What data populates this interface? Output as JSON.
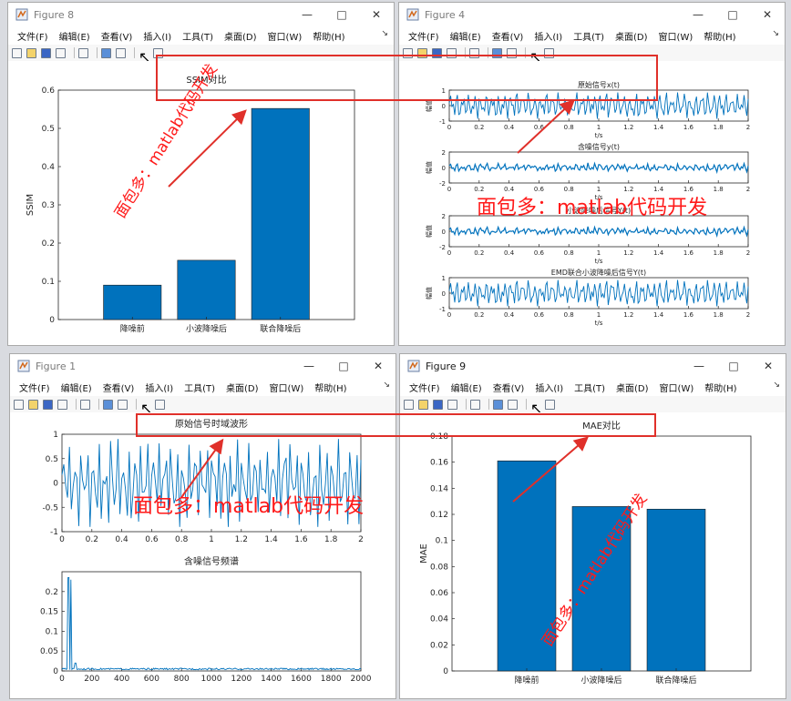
{
  "menu_items": [
    "文件(F)",
    "编辑(E)",
    "查看(V)",
    "插入(I)",
    "工具(T)",
    "桌面(D)",
    "窗口(W)",
    "帮助(H)"
  ],
  "icons": [
    "new-file-icon",
    "open-folder-icon",
    "save-icon",
    "print-icon",
    "link-icon",
    "insert-colorbar-icon",
    "insert-legend-icon",
    "pointer-icon",
    "property-inspector-icon"
  ],
  "watermark": "面包多：matlab代码开发",
  "colors": {
    "bar": "#0072BD",
    "line": "#0072BD",
    "watermark": "#ff1a1a"
  },
  "windows": {
    "fig8": {
      "title": "Figure 8"
    },
    "fig4": {
      "title": "Figure 4"
    },
    "fig1": {
      "title": "Figure 1"
    },
    "fig9": {
      "title": "Figure 9"
    }
  },
  "chart_data": [
    {
      "id": "ssim",
      "type": "bar",
      "title": "SSIM对比",
      "categories": [
        "降噪前",
        "小波降噪后",
        "联合降噪后"
      ],
      "values": [
        0.09,
        0.155,
        0.552
      ],
      "ylabel": "SSIM",
      "xlabel": "",
      "ylim": [
        0,
        0.6
      ],
      "yticks": [
        "0",
        "0.1",
        "0.2",
        "0.3",
        "0.4",
        "0.5",
        "0.6"
      ]
    },
    {
      "id": "mae",
      "type": "bar",
      "title": "MAE对比",
      "categories": [
        "降噪前",
        "小波降噪后",
        "联合降噪后"
      ],
      "values": [
        0.161,
        0.126,
        0.124
      ],
      "ylabel": "MAE",
      "xlabel": "",
      "ylim": [
        0,
        0.18
      ],
      "yticks": [
        "0",
        "0.02",
        "0.04",
        "0.06",
        "0.08",
        "0.1",
        "0.12",
        "0.14",
        "0.16",
        "0.18"
      ]
    },
    {
      "id": "sig1",
      "type": "line",
      "title": "原始信号x(t)",
      "xlabel": "t/s",
      "ylabel": "幅值",
      "xlim": [
        0,
        2
      ],
      "ylim": [
        -1,
        1
      ],
      "xticks": [
        "0",
        "0.2",
        "0.4",
        "0.6",
        "0.8",
        "1",
        "1.2",
        "1.4",
        "1.6",
        "1.8",
        "2"
      ],
      "yticks": [
        "-1",
        "0",
        "1"
      ]
    },
    {
      "id": "sig2",
      "type": "line",
      "title": "含噪信号y(t)",
      "xlabel": "t/s",
      "ylabel": "幅值",
      "xlim": [
        0,
        2
      ],
      "ylim": [
        -2,
        2
      ],
      "xticks": [
        "0",
        "0.2",
        "0.4",
        "0.6",
        "0.8",
        "1",
        "1.2",
        "1.4",
        "1.6",
        "1.8",
        "2"
      ],
      "yticks": [
        "-2",
        "0",
        "2"
      ]
    },
    {
      "id": "sig3",
      "type": "line",
      "title": "小波降噪后信号Y(t)",
      "xlabel": "t/s",
      "ylabel": "幅值",
      "xlim": [
        0,
        2
      ],
      "ylim": [
        -2,
        2
      ],
      "xticks": [
        "0",
        "0.2",
        "0.4",
        "0.6",
        "0.8",
        "1",
        "1.2",
        "1.4",
        "1.6",
        "1.8",
        "2"
      ],
      "yticks": [
        "-2",
        "0",
        "2"
      ]
    },
    {
      "id": "sig4",
      "type": "line",
      "title": "EMD联合小波降噪后信号Y(t)",
      "xlabel": "t/s",
      "ylabel": "幅值",
      "xlim": [
        0,
        2
      ],
      "ylim": [
        -1,
        1
      ],
      "xticks": [
        "0",
        "0.2",
        "0.4",
        "0.6",
        "0.8",
        "1",
        "1.2",
        "1.4",
        "1.6",
        "1.8",
        "2"
      ],
      "yticks": [
        "-1",
        "0",
        "1"
      ]
    },
    {
      "id": "wave",
      "type": "line",
      "title": "原始信号时域波形",
      "xlim": [
        0,
        2
      ],
      "ylim": [
        -1,
        1
      ],
      "xticks": [
        "0",
        "0.2",
        "0.4",
        "0.6",
        "0.8",
        "1",
        "1.2",
        "1.4",
        "1.6",
        "1.8",
        "2"
      ],
      "yticks": [
        "-1",
        "-0.5",
        "0",
        "0.5",
        "1"
      ]
    },
    {
      "id": "spec",
      "type": "line",
      "title": "含噪信号频谱",
      "xlim": [
        0,
        2000
      ],
      "ylim": [
        0,
        0.25
      ],
      "xticks": [
        "0",
        "200",
        "400",
        "600",
        "800",
        "1000",
        "1200",
        "1400",
        "1600",
        "1800",
        "2000"
      ],
      "yticks": [
        "0",
        "0.05",
        "0.1",
        "0.15",
        "0.2"
      ]
    }
  ]
}
